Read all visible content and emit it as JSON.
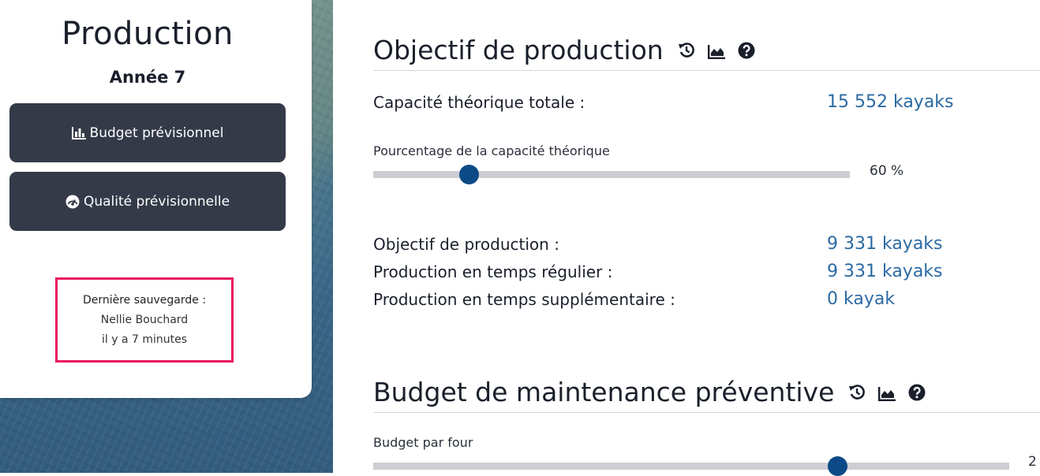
{
  "sidebar": {
    "title": "Production",
    "year": "Année 7",
    "buttons": [
      {
        "label": "Budget prévisionnel",
        "icon": "bar-chart-icon"
      },
      {
        "label": "Qualité prévisionnelle",
        "icon": "gauge-icon"
      }
    ],
    "save": {
      "heading": "Dernière sauvegarde :",
      "user": "Nellie Bouchard",
      "time": "il y a 7 minutes"
    }
  },
  "production": {
    "title": "Objectif de production",
    "icons": [
      "history-icon",
      "area-chart-icon",
      "help-icon"
    ],
    "capacity_label": "Capacité théorique totale :",
    "capacity_value": "15 552 kayaks",
    "slider_label": "Pourcentage de la capacité théorique",
    "slider_value_text": "60 %",
    "slider_value": 0.2,
    "objective_label": "Objectif de production :",
    "objective_value": "9 331 kayaks",
    "regular_label": "Production en temps régulier :",
    "regular_value": "9 331 kayaks",
    "overtime_label": "Production en temps supplémentaire :",
    "overtime_value": "0 kayak"
  },
  "maintenance": {
    "title": "Budget de maintenance préventive",
    "icons": [
      "history-icon",
      "area-chart-icon",
      "help-icon"
    ],
    "slider_label": "Budget par four",
    "slider_value_text": "2",
    "slider_value": 0.73
  },
  "colors": {
    "accent": "#2b6aa3",
    "button_bg": "#343a48",
    "highlight_border": "#e8175d",
    "slider_thumb": "#0c4a87"
  }
}
